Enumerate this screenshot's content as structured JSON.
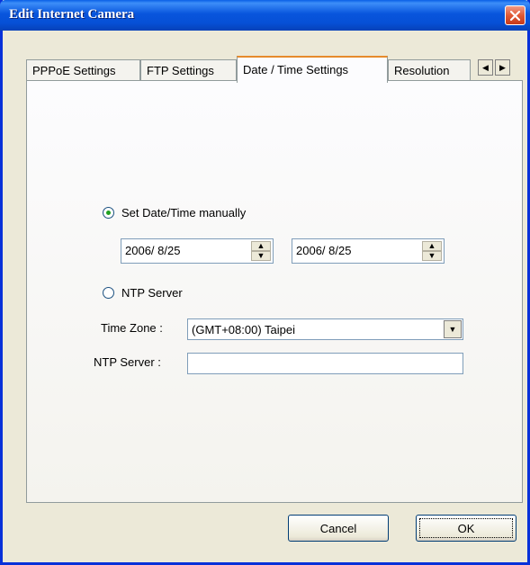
{
  "window": {
    "title": "Edit Internet Camera"
  },
  "tabs": [
    {
      "label": "PPPoE Settings"
    },
    {
      "label": "FTP Settings"
    },
    {
      "label": "Date / Time Settings"
    },
    {
      "label": "Resolution"
    }
  ],
  "datetime": {
    "manual_label": "Set Date/Time manually",
    "manual_selected": true,
    "date1": "2006/  8/25",
    "date2": "2006/  8/25",
    "ntp_label": "NTP Server",
    "timezone_label": "Time Zone :",
    "timezone_value": "(GMT+08:00) Taipei",
    "ntp_server_label": "NTP Server :",
    "ntp_server_value": ""
  },
  "buttons": {
    "cancel": "Cancel",
    "ok": "OK"
  },
  "icons": {
    "close": "close-icon",
    "tab_left": "left-arrow-icon",
    "tab_right": "right-arrow-icon",
    "dropdown": "chevron-down-icon"
  },
  "colors": {
    "titlebar": "#0855dd",
    "active_tab_accent": "#e68b2c",
    "close": "#e15a35"
  }
}
